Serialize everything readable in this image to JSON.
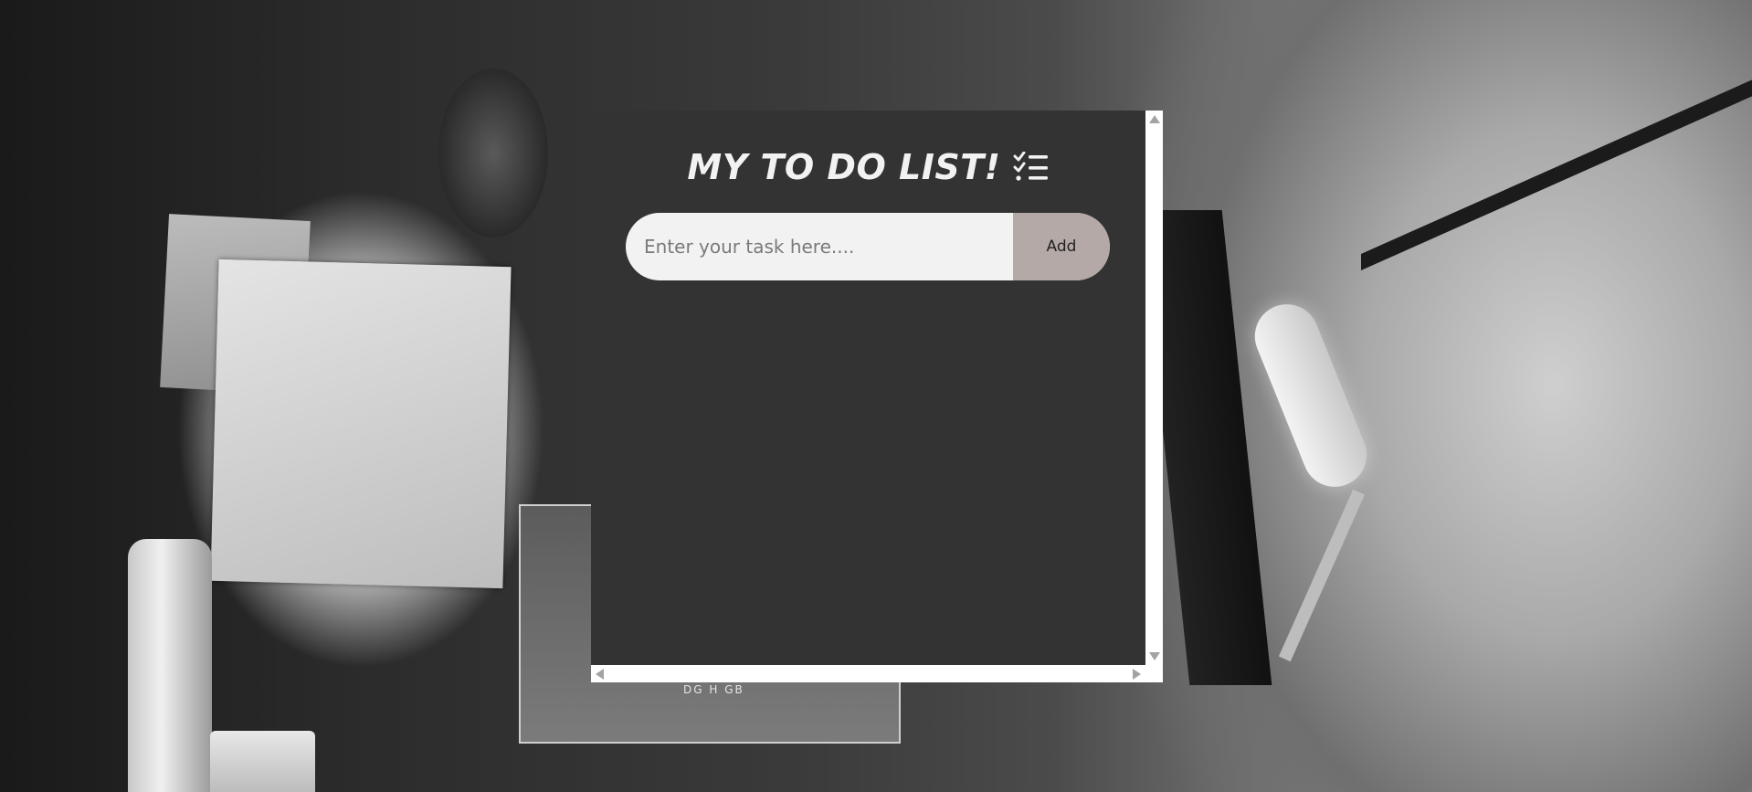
{
  "app": {
    "title": "MY TO DO LIST!",
    "title_icon": "checklist-icon"
  },
  "task_input": {
    "placeholder": "Enter your task here....",
    "value": ""
  },
  "add_button": {
    "label": "Add"
  },
  "tasks": [],
  "background": {
    "poster_text": "DG H GB"
  },
  "colors": {
    "panel": "#333333",
    "title_text": "#f2f2f2",
    "input_bg": "#f2f2f2",
    "add_button_bg": "#b5a9a7",
    "scrollbar": "#ffffff"
  }
}
